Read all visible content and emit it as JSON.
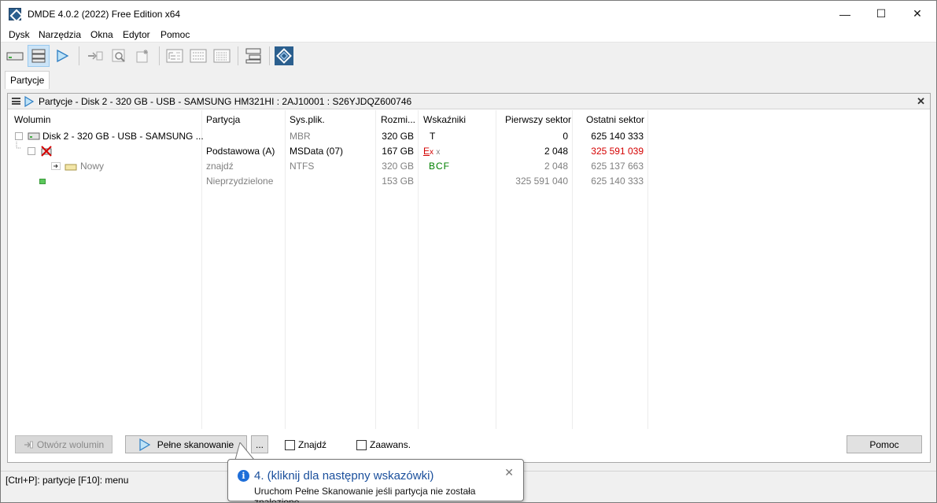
{
  "window": {
    "title": "DMDE 4.0.2 (2022) Free Edition x64",
    "min_glyph": "—",
    "max_glyph": "☐",
    "close_glyph": "✕"
  },
  "menu": [
    "Dysk",
    "Narzędzia",
    "Okna",
    "Edytor",
    "Pomoc"
  ],
  "toolbar": {
    "icons": [
      "disk-icon",
      "partitions-list-icon",
      "play-icon",
      "open-volume-icon",
      "search-icon",
      "settings-icon",
      "tree-view-icon",
      "list-view-icon",
      "grid-view-icon",
      "windows-icon",
      "dmde-logo-icon"
    ]
  },
  "tabs": [
    "Partycje"
  ],
  "panel": {
    "title": "Partycje - Disk 2 - 320 GB - USB - SAMSUNG HM321HI : 2AJ10001 : S26YJDQZ600746",
    "close_glyph": "✕",
    "columns": [
      "Wolumin",
      "Partycja",
      "Sys.plik.",
      "Rozmi...",
      "Wskaźniki",
      "Pierwszy sektor",
      "Ostatni sektor"
    ],
    "rows": [
      {
        "volume": "Disk 2 - 320 GB - USB - SAMSUNG ...",
        "partition": "",
        "fs": "MBR",
        "size": "320 GB",
        "flags": "T",
        "first": "0",
        "last": "625 140 333"
      },
      {
        "volume": "",
        "partition": "Podstawowa (A)",
        "fs": "MSData (07)",
        "size": "167 GB",
        "flags_e": "E",
        "flags_x1": "x",
        "flags_x2": "x",
        "first": "2 048",
        "last": "325 591 039"
      },
      {
        "volume": "Nowy",
        "partition": "znajdź",
        "fs": "NTFS",
        "size": "320 GB",
        "flags": "BCF",
        "first": "2 048",
        "last": "625 137 663"
      },
      {
        "volume": "",
        "partition": "Nieprzydzielone",
        "fs": "",
        "size": "153 GB",
        "flags": "",
        "first": "325 591 040",
        "last": "625 140 333"
      }
    ]
  },
  "buttons": {
    "open_volume": "Otwórz wolumin",
    "full_scan": "Pełne skanowanie",
    "more": "...",
    "help": "Pomoc"
  },
  "checkboxes": {
    "find": "Znajdź",
    "advanced": "Zaawans."
  },
  "status": "[Ctrl+P]: partycje  [F10]: menu",
  "tooltip": {
    "title": "4. (kliknij dla następny wskazówki)",
    "body": "Uruchom Pełne Skanowanie jeśli partycja nie została znalezione",
    "close_glyph": "✕"
  },
  "colors": {
    "accent": "#1a4f9c",
    "error_red": "#d40000",
    "ok_green": "#008000",
    "selected_tb": "#cce4f7"
  }
}
